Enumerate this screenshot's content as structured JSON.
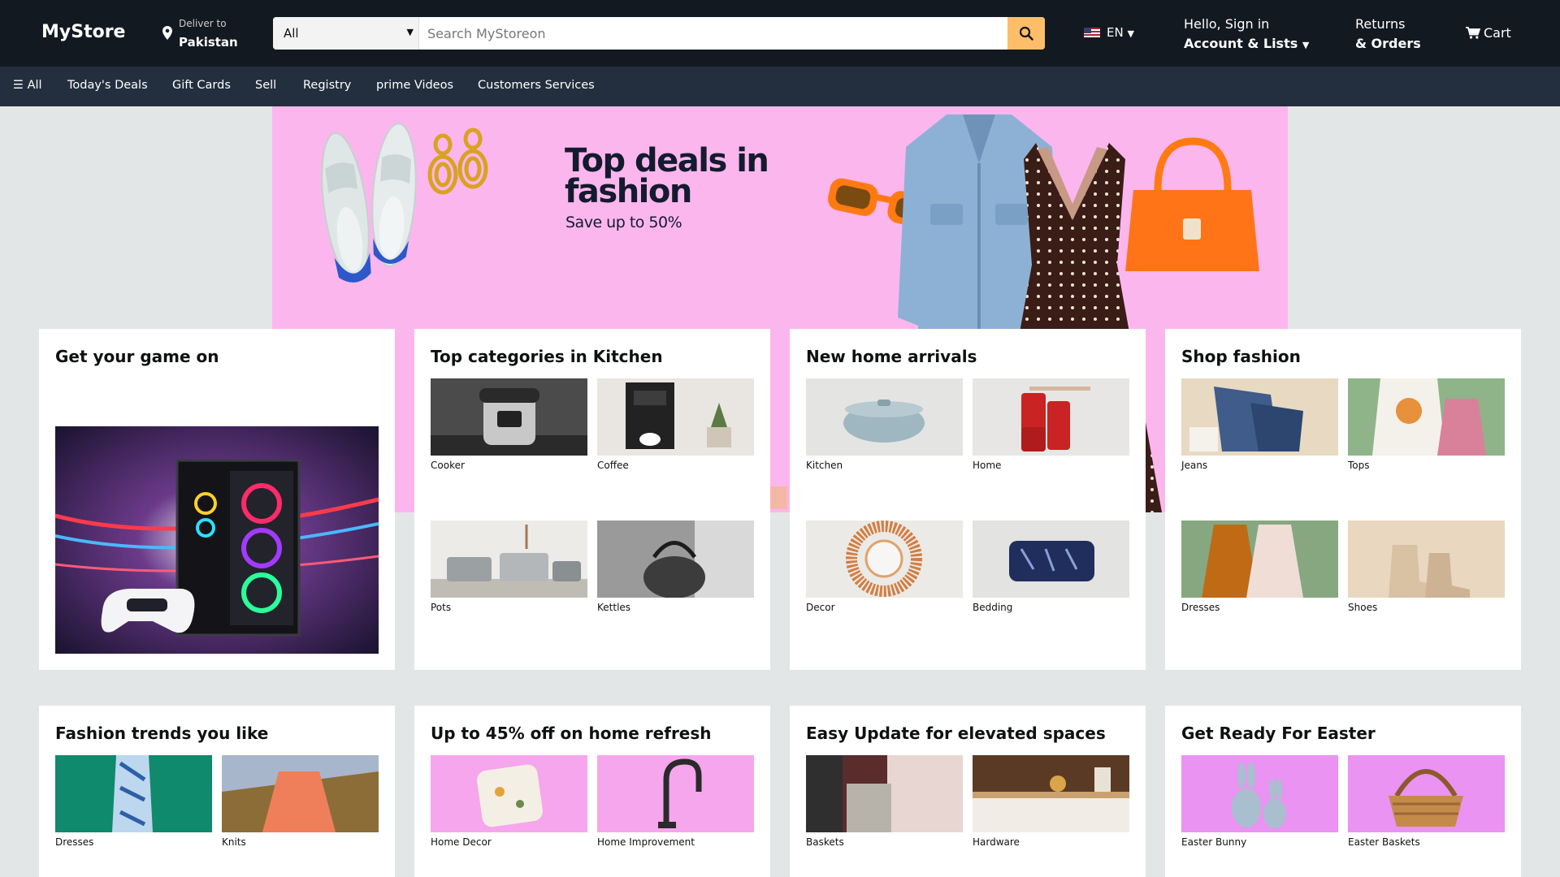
{
  "header": {
    "logo": "MyStore",
    "deliver_label": "Deliver to",
    "deliver_location": "Pakistan",
    "search_category": "All",
    "search_placeholder": "Search MyStoreon",
    "language": "EN",
    "account_line1": "Hello, Sign in",
    "account_line2": "Account & Lists",
    "orders_line1": "Returns",
    "orders_line2": "& Orders",
    "cart_label": "Cart"
  },
  "subnav": {
    "all_label": "All",
    "items": [
      "Today's Deals",
      "Gift Cards",
      "Sell",
      "Registry",
      "prime Videos",
      "Customers Services"
    ]
  },
  "hero": {
    "headline_line1": "Top deals in",
    "headline_line2": "fashion",
    "subheadline": "Save up to 50%"
  },
  "cards": [
    {
      "title": "Get your game on"
    },
    {
      "title": "Top categories in Kitchen",
      "tiles": [
        "Cooker",
        "Coffee",
        "Pots",
        "Kettles"
      ]
    },
    {
      "title": "New home arrivals",
      "tiles": [
        "Kitchen",
        "Home",
        "Decor",
        "Bedding"
      ]
    },
    {
      "title": "Shop fashion",
      "tiles": [
        "Jeans",
        "Tops",
        "Dresses",
        "Shoes"
      ]
    },
    {
      "title": "Fashion trends you like",
      "tiles": [
        "Dresses",
        "Knits"
      ]
    },
    {
      "title": "Up to 45% off on home refresh",
      "tiles": [
        "Home Decor",
        "Home Improvement"
      ]
    },
    {
      "title": "Easy Update for elevated spaces",
      "tiles": [
        "Baskets",
        "Hardware"
      ]
    },
    {
      "title": "Get Ready For Easter",
      "tiles": [
        "Easter Bunny",
        "Easter Baskets"
      ]
    }
  ],
  "colors": {
    "header_bg": "#131921",
    "subnav_bg": "#232f3e",
    "search_button": "#febd69",
    "hero_bg": "#fcb6ee",
    "page_bg": "#e3e6e6"
  }
}
